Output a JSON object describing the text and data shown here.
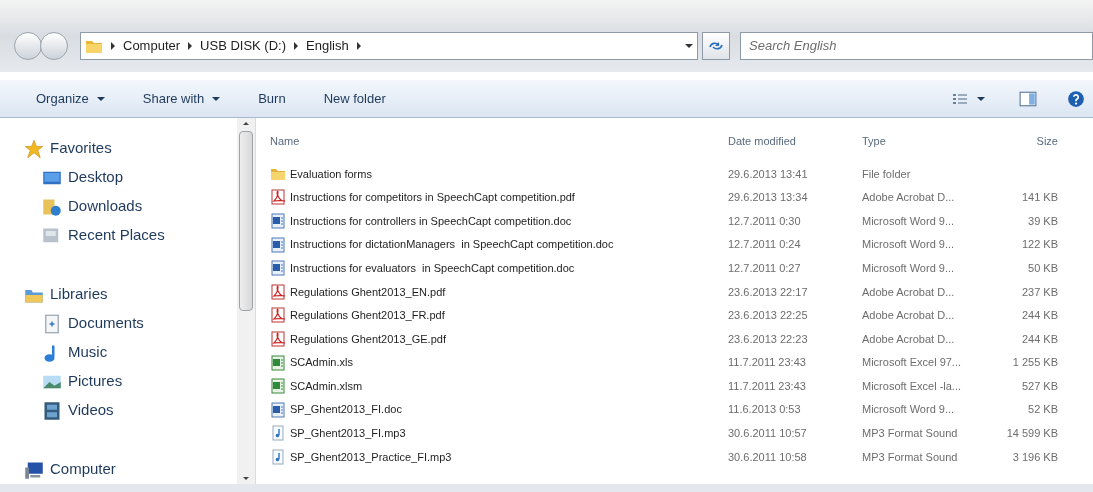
{
  "address_bar": {
    "crumbs": [
      "Computer",
      "USB DISK (D:)",
      "English"
    ]
  },
  "search": {
    "placeholder": "Search English"
  },
  "toolbar": {
    "buttons": [
      {
        "label": "Organize",
        "dropdown": true
      },
      {
        "label": "Share with",
        "dropdown": true
      },
      {
        "label": "Burn",
        "dropdown": false
      },
      {
        "label": "New folder",
        "dropdown": false
      }
    ]
  },
  "navigation": {
    "groups": [
      {
        "label": "Favorites",
        "kind": "star",
        "children": [
          {
            "label": "Desktop",
            "kind": "desktop"
          },
          {
            "label": "Downloads",
            "kind": "downloads"
          },
          {
            "label": "Recent Places",
            "kind": "recent"
          }
        ]
      },
      {
        "label": "Libraries",
        "kind": "libraries",
        "children": [
          {
            "label": "Documents",
            "kind": "documents"
          },
          {
            "label": "Music",
            "kind": "music"
          },
          {
            "label": "Pictures",
            "kind": "pictures"
          },
          {
            "label": "Videos",
            "kind": "videos"
          }
        ]
      },
      {
        "label": "Computer",
        "kind": "computer"
      }
    ]
  },
  "table": {
    "columns": [
      "Name",
      "Date modified",
      "Type",
      "Size"
    ],
    "rows": [
      {
        "kind": "folder",
        "name": "Evaluation forms",
        "date": "29.6.2013 13:41",
        "type": "File folder"
      },
      {
        "kind": "pdf",
        "name": "Instructions for competitors in SpeechCapt competition.pdf",
        "date": "29.6.2013 13:34",
        "type": "Adobe Acrobat D...",
        "size": "141 KB"
      },
      {
        "kind": "word",
        "name": "Instructions for controllers in SpeechCapt competition.doc",
        "date": "12.7.2011 0:30",
        "type": "Microsoft Word 9...",
        "size": "39 KB"
      },
      {
        "kind": "word",
        "name": "Instructions for dictationManagers  in SpeechCapt competition.doc",
        "date": "12.7.2011 0:24",
        "type": "Microsoft Word 9...",
        "size": "122 KB"
      },
      {
        "kind": "word",
        "name": "Instructions for evaluators  in SpeechCapt competition.doc",
        "date": "12.7.2011 0:27",
        "type": "Microsoft Word 9...",
        "size": "50 KB"
      },
      {
        "kind": "pdf",
        "name": "Regulations Ghent2013_EN.pdf",
        "date": "23.6.2013 22:17",
        "type": "Adobe Acrobat D...",
        "size": "237 KB"
      },
      {
        "kind": "pdf",
        "name": "Regulations Ghent2013_FR.pdf",
        "date": "23.6.2013 22:25",
        "type": "Adobe Acrobat D...",
        "size": "244 KB"
      },
      {
        "kind": "pdf",
        "name": "Regulations Ghent2013_GE.pdf",
        "date": "23.6.2013 22:23",
        "type": "Adobe Acrobat D...",
        "size": "244 KB"
      },
      {
        "kind": "excel",
        "name": "SCAdmin.xls",
        "date": "11.7.2011 23:43",
        "type": "Microsoft Excel 97...",
        "size": "1 255 KB"
      },
      {
        "kind": "excel",
        "name": "SCAdmin.xlsm",
        "date": "11.7.2011 23:43",
        "type": "Microsoft Excel -la...",
        "size": "527 KB"
      },
      {
        "kind": "word",
        "name": "SP_Ghent2013_FI.doc",
        "date": "11.6.2013 0:53",
        "type": "Microsoft Word 9...",
        "size": "52 KB"
      },
      {
        "kind": "audio",
        "name": "SP_Ghent2013_FI.mp3",
        "date": "30.6.2011 10:57",
        "type": "MP3 Format Sound",
        "size": "14 599 KB"
      },
      {
        "kind": "audio",
        "name": "SP_Ghent2013_Practice_FI.mp3",
        "date": "30.6.2011 10:58",
        "type": "MP3 Format Sound",
        "size": "3 196 KB"
      }
    ]
  }
}
